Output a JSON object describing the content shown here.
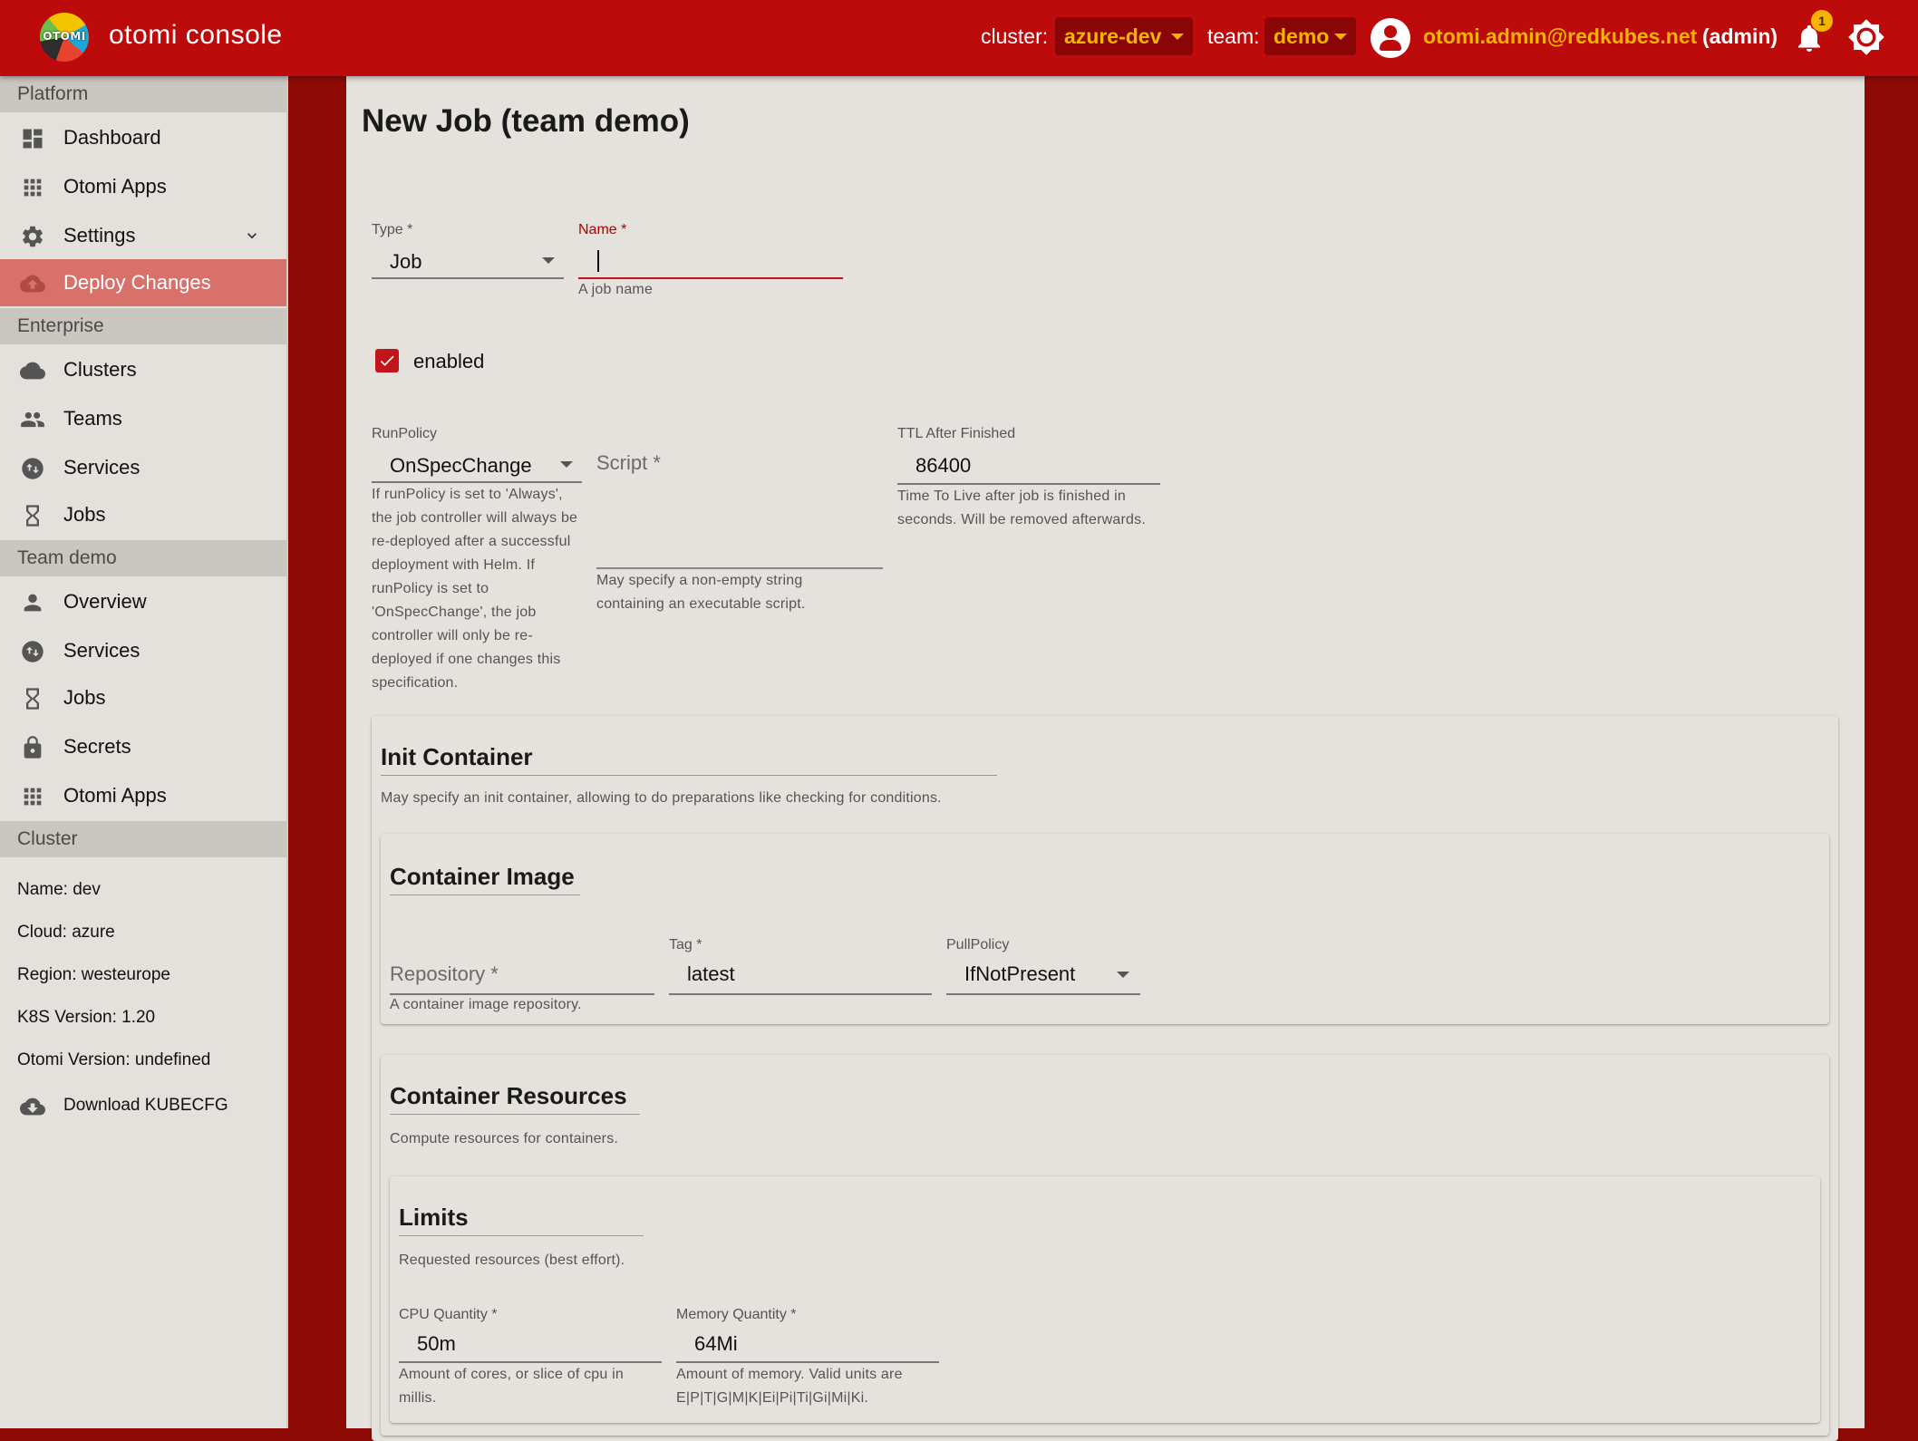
{
  "topbar": {
    "logo_text": "OTOMI",
    "app_title": "otomi console",
    "cluster_label": "cluster:",
    "cluster_value": "azure-dev",
    "team_label": "team:",
    "team_value": "demo",
    "user_email": "otomi.admin@redkubes.net",
    "user_role": "(admin)",
    "notification_count": "1",
    "accent_color": "#f5b400",
    "bar_color": "#bd0a0a"
  },
  "sidebar": {
    "platform_header": "Platform",
    "platform_items": [
      {
        "label": "Dashboard",
        "icon": "dashboard-icon"
      },
      {
        "label": "Otomi Apps",
        "icon": "apps-grid-icon"
      },
      {
        "label": "Settings",
        "icon": "gear-icon"
      },
      {
        "label": "Deploy Changes",
        "icon": "cloud-upload-icon"
      }
    ],
    "enterprise_header": "Enterprise",
    "enterprise_items": [
      {
        "label": "Clusters",
        "icon": "cloud-icon"
      },
      {
        "label": "Teams",
        "icon": "people-icon"
      },
      {
        "label": "Services",
        "icon": "swap-icon"
      },
      {
        "label": "Jobs",
        "icon": "hourglass-icon"
      }
    ],
    "team_header": "Team demo",
    "team_items": [
      {
        "label": "Overview",
        "icon": "person-icon"
      },
      {
        "label": "Services",
        "icon": "swap-icon"
      },
      {
        "label": "Jobs",
        "icon": "hourglass-icon"
      },
      {
        "label": "Secrets",
        "icon": "lock-icon"
      },
      {
        "label": "Otomi Apps",
        "icon": "apps-grid-icon"
      }
    ],
    "cluster_header": "Cluster",
    "cluster_info": {
      "name": "Name: dev",
      "cloud": "Cloud: azure",
      "region": "Region: westeurope",
      "k8s": "K8S Version: 1.20",
      "otomi": "Otomi Version: undefined"
    },
    "download": "Download KUBECFG"
  },
  "form": {
    "title": "New Job (team demo)",
    "type_label": "Type *",
    "type_value": "Job",
    "name_label": "Name *",
    "name_value": "",
    "name_help": "A job name",
    "enabled_label": "enabled",
    "enabled_checked": true,
    "runpolicy_label": "RunPolicy",
    "runpolicy_value": "OnSpecChange",
    "runpolicy_help": "If runPolicy is set to 'Always', the job controller will always be re-deployed after a successful deployment with Helm. If runPolicy is set to 'OnSpecChange', the job controller will only be re-deployed if one changes this specification.",
    "script_placeholder": "Script *",
    "script_help": "May specify a non-empty string containing an executable script.",
    "ttl_label": "TTL After Finished",
    "ttl_value": "86400",
    "ttl_help": "Time To Live after job is finished in seconds. Will be removed afterwards."
  },
  "init_container": {
    "title": "Init Container",
    "description": "May specify an init container, allowing to do preparations like checking for conditions.",
    "image": {
      "title": "Container Image",
      "repository_placeholder": "Repository *",
      "repository_help": "A container image repository.",
      "tag_label": "Tag *",
      "tag_value": "latest",
      "pullpolicy_label": "PullPolicy",
      "pullpolicy_value": "IfNotPresent"
    },
    "resources": {
      "title": "Container Resources",
      "description": "Compute resources for containers.",
      "limits": {
        "title": "Limits",
        "description": "Requested resources (best effort).",
        "cpu_label": "CPU Quantity *",
        "cpu_value": "50m",
        "cpu_help": "Amount of cores, or slice of cpu in millis.",
        "memory_label": "Memory Quantity *",
        "memory_value": "64Mi",
        "memory_help": "Amount of memory. Valid units are E|P|T|G|M|K|Ei|Pi|Ti|Gi|Mi|Ki."
      }
    }
  }
}
